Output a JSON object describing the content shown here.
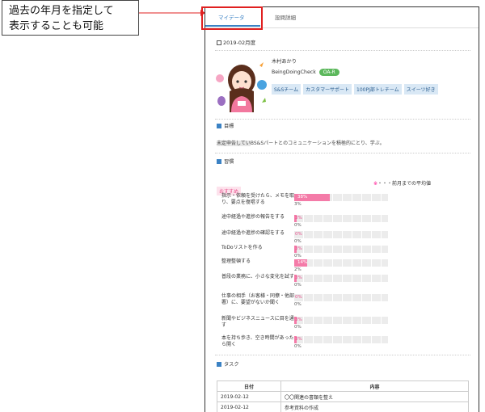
{
  "callout": {
    "line1": "過去の年月を指定して",
    "line2": "表示することも可能"
  },
  "tabs": [
    {
      "label": "マイデータ"
    },
    {
      "label": "設問詳細"
    }
  ],
  "period": "2019-02月度",
  "user": {
    "name": "木村あかり",
    "system": "BeingDoingCheck",
    "rank": "OA-R",
    "tags": [
      "S&Sチーム",
      "カスタマーサポート",
      "100PJ部トレチーム",
      "スイーツ好き"
    ]
  },
  "sections": {
    "goal": "目標",
    "tasks_head": "習慣",
    "task_list": "タスク"
  },
  "goal": {
    "masked": "未定申告してい",
    "text": "BS&Sパートとのコミュニケーションを積極的にとり、学ぶ。"
  },
  "note": {
    "star": "※",
    "text": "・・・前月までの平均値"
  },
  "recommend": "おすすめ",
  "habits": [
    {
      "label": "指示・依頼を受けたら、メモを取り、要点を復唱する",
      "pct": "38%",
      "value": 38,
      "avg": "3%"
    },
    {
      "label": "途中経過や進捗の報告をする",
      "pct": "3%",
      "value": 3,
      "avg": "0%"
    },
    {
      "label": "途中経過や進捗の確認をする",
      "pct": "0%",
      "value": 0,
      "avg": "0%"
    },
    {
      "label": "ToDoリストを作る",
      "pct": "3%",
      "value": 3,
      "avg": "0%"
    },
    {
      "label": "整理整頓する",
      "pct": "14%",
      "value": 14,
      "avg": "2%"
    },
    {
      "label": "普段の業務に、小さな変化を試す",
      "pct": "3%",
      "value": 3,
      "avg": "0%"
    },
    {
      "label": "仕事の相手（お客様・同僚・他部署）に、要望がないか聞く",
      "pct": "0%",
      "value": 0,
      "avg": "0%"
    },
    {
      "label": "新聞やビジネスニュースに目を通す",
      "pct": "3%",
      "value": 3,
      "avg": "0%"
    },
    {
      "label": "本を持ち歩き、空き時間があったら開く",
      "pct": "3%",
      "value": 3,
      "avg": "0%"
    }
  ],
  "task_table": {
    "headers": [
      "日付",
      "内容"
    ],
    "rows": [
      [
        "2019-02-12",
        "〇〇関連の書類を整え"
      ],
      [
        "2019-02-12",
        "参考資料の作成"
      ]
    ]
  }
}
